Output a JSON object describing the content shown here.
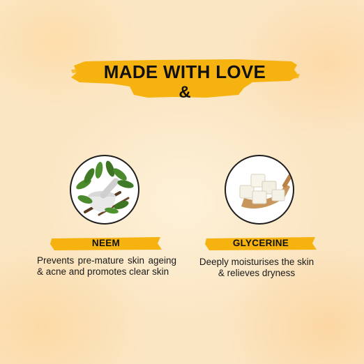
{
  "headline": {
    "line1": "MADE WITH LOVE",
    "line2": "&"
  },
  "ingredients": [
    {
      "name": "NEEM",
      "description": "Prevents pre-mature skin ageing & acne and promotes clear skin",
      "icon": "neem-leaves-mortar-icon"
    },
    {
      "name": "GLYCERINE",
      "description": "Deeply moisturises the skin & relieves dryness",
      "icon": "glycerine-cubes-spoon-icon"
    }
  ],
  "colors": {
    "accent": "#f6b20f",
    "background": "#fbe6c4",
    "text": "#111111"
  }
}
